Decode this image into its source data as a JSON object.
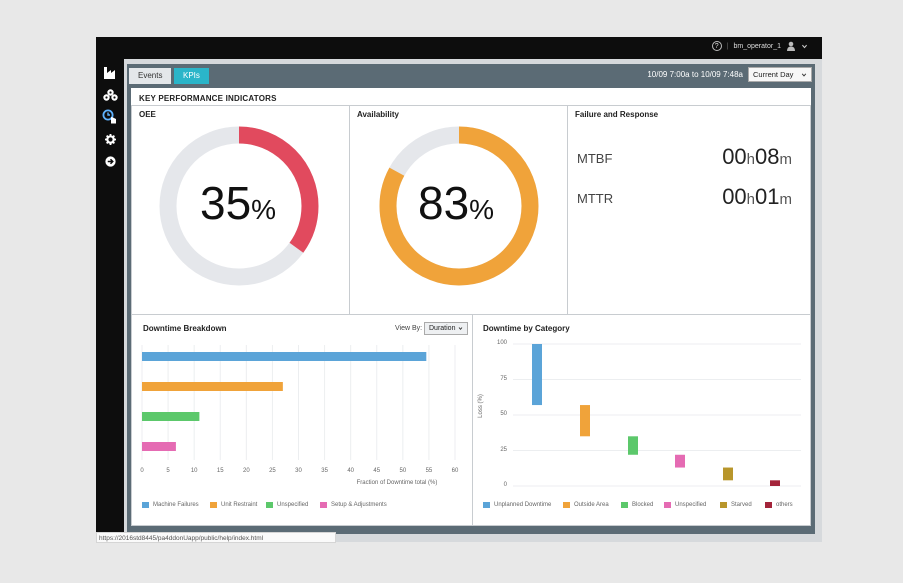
{
  "header": {
    "help_icon": "help-circle-icon",
    "username": "bm_operator_1",
    "user_icon": "user-avatar-icon"
  },
  "sidebar": {
    "items": [
      {
        "name": "factory-icon"
      },
      {
        "name": "assets-icon"
      },
      {
        "name": "kpi-dashboard-icon",
        "active": true
      },
      {
        "name": "settings-icon"
      },
      {
        "name": "logout-icon"
      }
    ]
  },
  "toolbar": {
    "tabs": [
      {
        "label": "Events"
      },
      {
        "label": "KPIs",
        "active": true
      }
    ],
    "date_range": "10/09 7:00a to 10/09 7:48a",
    "range_select": "Current Day"
  },
  "kpi": {
    "title": "KEY PERFORMANCE INDICATORS",
    "oee": {
      "label": "OEE",
      "value": "35",
      "unit": "%",
      "fraction": 0.35,
      "color": "#e14a5e"
    },
    "availability": {
      "label": "Availability",
      "value": "83",
      "unit": "%",
      "fraction": 0.83,
      "color": "#f0a33a"
    },
    "failure": {
      "title": "Failure and Response",
      "mtbf_label": "MTBF",
      "mtbf_h": "00",
      "mtbf_m": "08",
      "mttr_label": "MTTR",
      "mttr_h": "00",
      "mttr_m": "01",
      "h_unit": "h",
      "m_unit": "m"
    }
  },
  "downtime_breakdown": {
    "title": "Downtime Breakdown",
    "view_by_label": "View By:",
    "view_by_value": "Duration",
    "xlabel": "Fraction of Downtime total (%)",
    "x_ticks": [
      "0",
      "5",
      "10",
      "15",
      "20",
      "25",
      "30",
      "35",
      "40",
      "45",
      "50",
      "55",
      "60"
    ],
    "legend": [
      {
        "label": "Machine Failures",
        "color": "#5ba4d8"
      },
      {
        "label": "Unit Restraint",
        "color": "#f0a33a"
      },
      {
        "label": "Unspecified",
        "color": "#5cc86b"
      },
      {
        "label": "Setup & Adjustments",
        "color": "#e56bb3"
      }
    ]
  },
  "downtime_category": {
    "title": "Downtime by Category",
    "ylabel": "Loss (%)",
    "y_ticks": [
      "100",
      "75",
      "50",
      "25",
      "0"
    ],
    "legend": [
      {
        "label": "Unplanned Downtime",
        "color": "#5ba4d8"
      },
      {
        "label": "Outside Area",
        "color": "#f0a33a"
      },
      {
        "label": "Blocked",
        "color": "#5cc86b"
      },
      {
        "label": "Unspecified",
        "color": "#e56bb3"
      },
      {
        "label": "Starved",
        "color": "#b8962b"
      },
      {
        "label": "others",
        "color": "#a3243a"
      }
    ]
  },
  "chart_data": [
    {
      "type": "bar",
      "orientation": "horizontal",
      "title": "Downtime Breakdown",
      "xlabel": "Fraction of Downtime total (%)",
      "xlim": [
        0,
        60
      ],
      "categories": [
        "Machine Failures",
        "Unit Restraint",
        "Unspecified",
        "Setup & Adjustments"
      ],
      "values": [
        54.5,
        27,
        11,
        6.5
      ],
      "colors": [
        "#5ba4d8",
        "#f0a33a",
        "#5cc86b",
        "#e56bb3"
      ],
      "legend": "bottom",
      "grid": true
    },
    {
      "type": "bar",
      "subtype": "waterfall",
      "title": "Downtime by Category",
      "ylabel": "Loss (%)",
      "ylim": [
        0,
        100
      ],
      "categories": [
        "Unplanned Downtime",
        "Outside Area",
        "Blocked",
        "Unspecified",
        "Starved",
        "others"
      ],
      "ranges": [
        [
          57,
          100
        ],
        [
          35,
          57
        ],
        [
          22,
          35
        ],
        [
          13,
          22
        ],
        [
          4,
          13
        ],
        [
          0,
          4
        ]
      ],
      "colors": [
        "#5ba4d8",
        "#f0a33a",
        "#5cc86b",
        "#e56bb3",
        "#b8962b",
        "#a3243a"
      ],
      "legend": "bottom",
      "grid": true
    }
  ],
  "status_url": "https://2016std8445/pa4ddonUapp/public/help/index.html"
}
